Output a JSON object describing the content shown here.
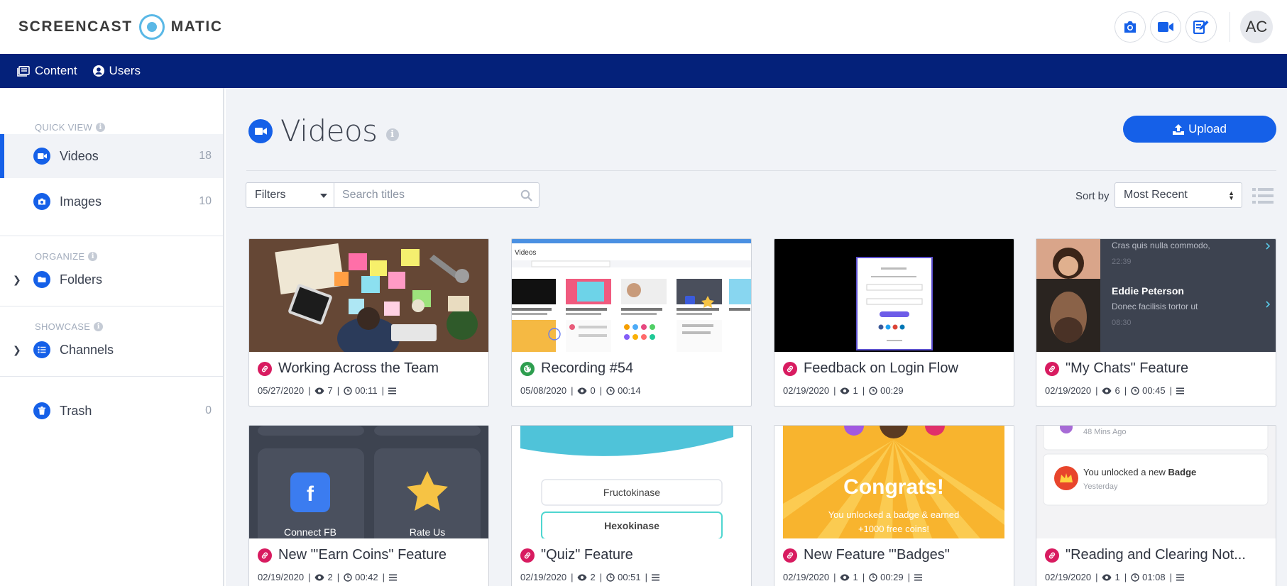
{
  "app": {
    "logo_left": "SCREENCAST",
    "logo_right": "MATIC",
    "avatar_initials": "AC"
  },
  "nav": {
    "content_label": "Content",
    "users_label": "Users"
  },
  "sidebar": {
    "quick_view_label": "QUICK VIEW",
    "organize_label": "ORGANIZE",
    "showcase_label": "SHOWCASE",
    "videos_label": "Videos",
    "videos_count": "18",
    "images_label": "Images",
    "images_count": "10",
    "folders_label": "Folders",
    "channels_label": "Channels",
    "trash_label": "Trash",
    "trash_count": "0"
  },
  "main": {
    "title": "Videos",
    "upload_label": "Upload",
    "filters_label": "Filters",
    "search_placeholder": "Search titles",
    "sort_label": "Sort by",
    "sort_value": "Most Recent"
  },
  "videos": [
    {
      "title": "Working Across the Team",
      "date": "05/27/2020",
      "views": "7",
      "duration": "00:11",
      "badge": "link"
    },
    {
      "title": "Recording #54",
      "date": "05/08/2020",
      "views": "0",
      "duration": "00:14",
      "badge": "public"
    },
    {
      "title": "Feedback on Login Flow",
      "date": "02/19/2020",
      "views": "1",
      "duration": "00:29",
      "badge": "link"
    },
    {
      "title": "\"My Chats\" Feature",
      "date": "02/19/2020",
      "views": "6",
      "duration": "00:45",
      "badge": "link"
    },
    {
      "title": "New \"'Earn Coins\" Feature",
      "date": "02/19/2020",
      "views": "2",
      "duration": "00:42",
      "badge": "link"
    },
    {
      "title": "\"Quiz\" Feature",
      "date": "02/19/2020",
      "views": "2",
      "duration": "00:51",
      "badge": "link"
    },
    {
      "title": "New Feature \"'Badges\"",
      "date": "02/19/2020",
      "views": "1",
      "duration": "00:29",
      "badge": "link"
    },
    {
      "title": "\"Reading and Clearing Not...",
      "date": "02/19/2020",
      "views": "1",
      "duration": "01:08",
      "badge": "link"
    }
  ],
  "thumb_text": {
    "t3_header": "Videos",
    "t4_row1": "Cras quis nulla commodo,",
    "t4_time1": "22:39",
    "t4_name": "Eddie Peterson",
    "t4_msg": "Donec facilisis tortor ut",
    "t4_time2": "08:30",
    "t5_left": "Connect FB",
    "t5_right": "Rate Us",
    "t6_opt1": "Fructokinase",
    "t6_opt2": "Hexokinase",
    "t7_title": "Congrats!",
    "t7_line1": "You unlocked a badge & earned",
    "t7_line2": "+1000 free coins!",
    "t8_time_top": "48 Mins Ago",
    "t8_text_a": "You unlocked a new ",
    "t8_text_b": "Badge",
    "t8_time": "Yesterday"
  },
  "colors": {
    "accent": "#1560e8",
    "navbar": "#04217a",
    "link_badge": "#d81b60",
    "public_badge": "#2e9e4f"
  },
  "icons": [
    "camera-icon",
    "video-camera-icon",
    "edit-icon",
    "content-icon",
    "user-circle-icon",
    "search-icon",
    "upload-icon",
    "list-view-icon",
    "eye-icon",
    "clock-icon",
    "link-icon",
    "globe-icon",
    "trash-icon",
    "folder-icon",
    "channel-icon"
  ]
}
